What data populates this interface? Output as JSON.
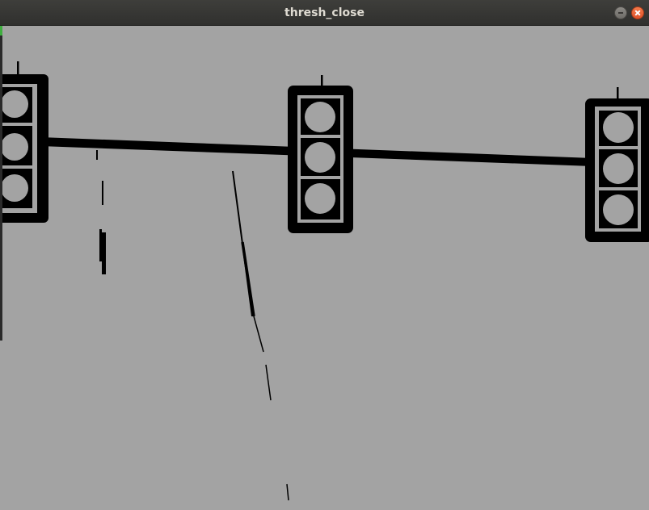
{
  "window": {
    "title": "thresh_close"
  },
  "image": {
    "description_icon": "binary-threshold-image",
    "background_color": "#a3a3a3",
    "foreground_color": "#000000"
  }
}
